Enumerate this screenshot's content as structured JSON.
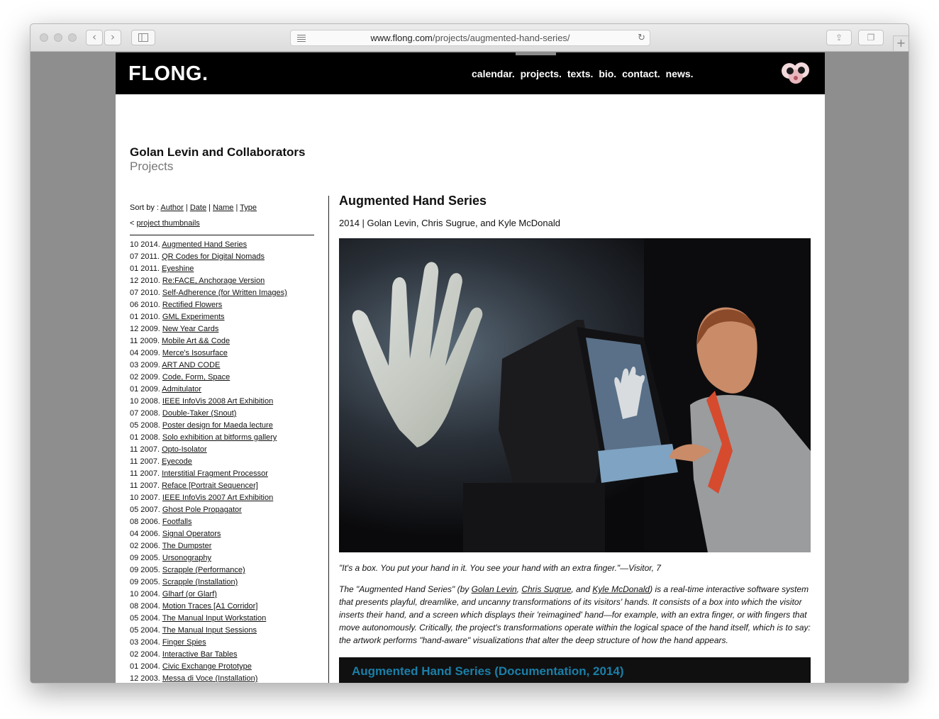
{
  "browser": {
    "url_host": "www.flong.com",
    "url_path": "/projects/augmented-hand-series/",
    "back_icon": "chevron-left",
    "forward_icon": "chevron-right"
  },
  "site": {
    "logo": "FLONG.",
    "nav": [
      "calendar.",
      "projects.",
      "texts.",
      "bio.",
      "contact.",
      "news."
    ],
    "title": "Golan Levin and Collaborators",
    "subtitle": "Projects"
  },
  "sidebar": {
    "sort_label": "Sort by :",
    "sort_options": [
      "Author",
      "Date",
      "Name",
      "Type"
    ],
    "thumbs_prefix": "<",
    "thumbs_link": "project thumbnails",
    "projects": [
      {
        "date": "10 2014.",
        "name": "Augmented Hand Series"
      },
      {
        "date": "07 2011.",
        "name": "QR Codes for Digital Nomads"
      },
      {
        "date": "01 2011.",
        "name": "Eyeshine"
      },
      {
        "date": "12 2010.",
        "name": "Re:FACE, Anchorage Version"
      },
      {
        "date": "07 2010.",
        "name": "Self-Adherence (for Written Images)"
      },
      {
        "date": "06 2010.",
        "name": "Rectified Flowers"
      },
      {
        "date": "01 2010.",
        "name": "GML Experiments"
      },
      {
        "date": "12 2009.",
        "name": "New Year Cards"
      },
      {
        "date": "11 2009.",
        "name": "Mobile Art && Code"
      },
      {
        "date": "04 2009.",
        "name": "Merce's Isosurface"
      },
      {
        "date": "03 2009.",
        "name": "ART AND CODE"
      },
      {
        "date": "02 2009.",
        "name": "Code, Form, Space"
      },
      {
        "date": "01 2009.",
        "name": "Admitulator"
      },
      {
        "date": "10 2008.",
        "name": "IEEE InfoVis 2008 Art Exhibition"
      },
      {
        "date": "07 2008.",
        "name": "Double-Taker (Snout)"
      },
      {
        "date": "05 2008.",
        "name": "Poster design for Maeda lecture"
      },
      {
        "date": "01 2008.",
        "name": "Solo exhibition at bitforms gallery"
      },
      {
        "date": "11 2007.",
        "name": "Opto-Isolator"
      },
      {
        "date": "11 2007.",
        "name": "Eyecode"
      },
      {
        "date": "11 2007.",
        "name": "Interstitial Fragment Processor"
      },
      {
        "date": "11 2007.",
        "name": "Reface [Portrait Sequencer]"
      },
      {
        "date": "10 2007.",
        "name": "IEEE InfoVis 2007 Art Exhibition"
      },
      {
        "date": "05 2007.",
        "name": "Ghost Pole Propagator"
      },
      {
        "date": "08 2006.",
        "name": "Footfalls"
      },
      {
        "date": "04 2006.",
        "name": "Signal Operators"
      },
      {
        "date": "02 2006.",
        "name": "The Dumpster"
      },
      {
        "date": "09 2005.",
        "name": "Ursonography"
      },
      {
        "date": "09 2005.",
        "name": "Scrapple (Performance)"
      },
      {
        "date": "09 2005.",
        "name": "Scrapple (Installation)"
      },
      {
        "date": "10 2004.",
        "name": "Glharf (or Glarf)"
      },
      {
        "date": "08 2004.",
        "name": "Motion Traces [A1 Corridor]"
      },
      {
        "date": "05 2004.",
        "name": "The Manual Input Workstation"
      },
      {
        "date": "05 2004.",
        "name": "The Manual Input Sessions"
      },
      {
        "date": "03 2004.",
        "name": "Finger Spies"
      },
      {
        "date": "02 2004.",
        "name": "Interactive Bar Tables"
      },
      {
        "date": "01 2004.",
        "name": "Civic Exchange Prototype"
      },
      {
        "date": "12 2003.",
        "name": "Messa di Voce (Installation)"
      }
    ]
  },
  "project": {
    "title": "Augmented Hand Series",
    "meta": "2014 | Golan Levin, Chris Sugrue, and Kyle McDonald",
    "quote": "\"It's a box. You put your hand in it. You see your hand with an extra finger.\"—Visitor, 7",
    "desc_1": "The \"Augmented Hand Series\" (by ",
    "author_1": "Golan Levin",
    "desc_2": ", ",
    "author_2": "Chris Sugrue",
    "desc_3": ", and ",
    "author_3": "Kyle McDonald",
    "desc_4": ") is a real-time interactive software system that presents playful, dreamlike, and uncanny transformations of its visitors' hands. It consists of a box into which the visitor inserts their hand, and a screen which displays their 'reimagined' hand—for example, with an extra finger, or with fingers that move autonomously. Critically, the project's transformations operate within the logical space of the hand itself, which is to say: the artwork performs \"hand-aware\" visualizations that alter the deep structure of how the hand appears.",
    "video_title": "Augmented Hand Series (Documentation, 2014)"
  },
  "colors": {
    "topbar": "#000000",
    "video_title": "#1a7fa8"
  }
}
